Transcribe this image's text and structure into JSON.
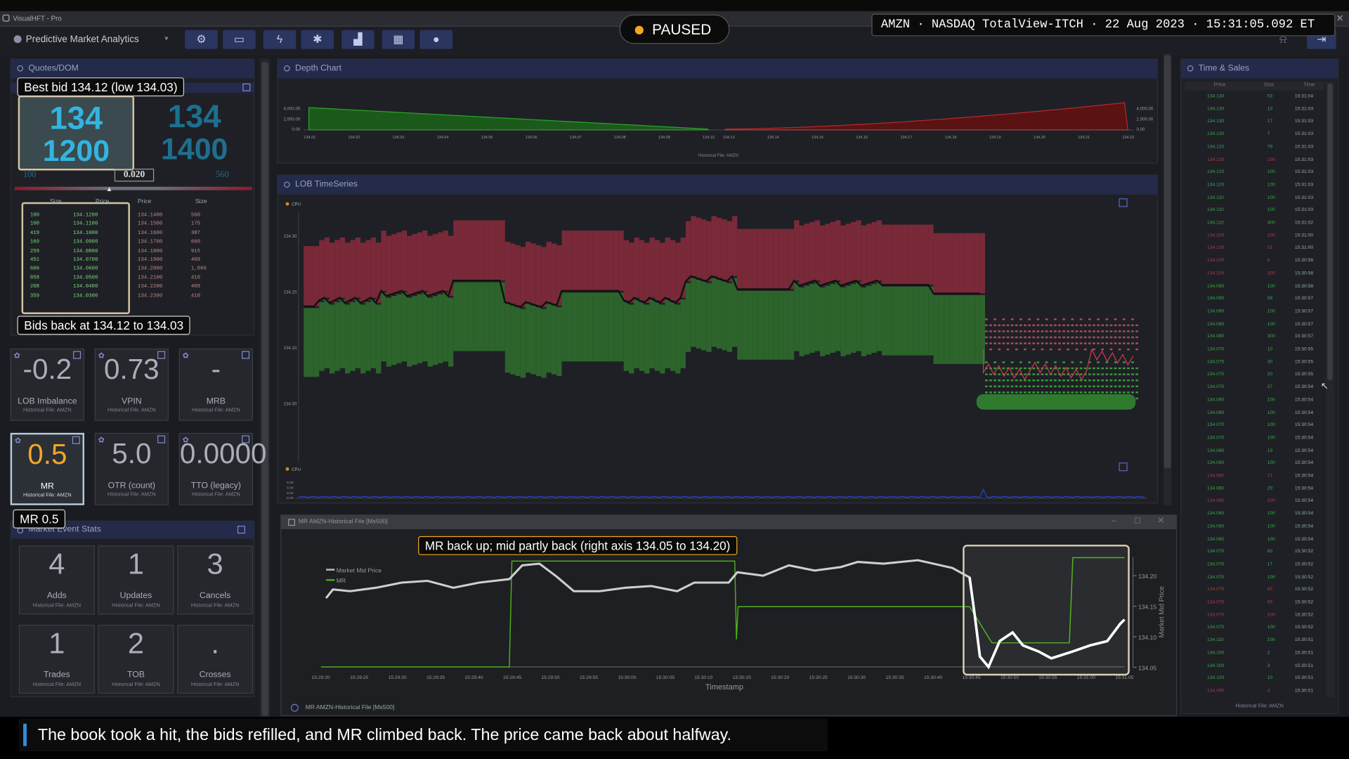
{
  "window_title": "VisualHFT - Pro",
  "app_title": "Predictive Market Analytics",
  "status": {
    "label": "PAUSED"
  },
  "header_info": "AMZN · NASDAQ TotalView-ITCH · 22 Aug 2023 · 15:31:05.092 ET",
  "toolbar": {
    "icons": [
      "gear-icon",
      "monitor-icon",
      "bolt-icon",
      "puzzle-icon",
      "chart-icon",
      "keyboard-icon",
      "user-icon",
      "bell-icon",
      "logout-icon"
    ]
  },
  "quotes": {
    "title": "Quotes/DOM",
    "bid_price": "134",
    "bid_size": "1200",
    "ask_price": "134",
    "ask_size": "1400",
    "left_small": "100",
    "spread": "0.020",
    "right_small": "560",
    "headers": {
      "bid_size": "Size",
      "bid_price": "Price",
      "ask_price": "Price",
      "ask_size": "Size"
    },
    "bids": [
      {
        "size": "100",
        "price": "134.1200"
      },
      {
        "size": "100",
        "price": "134.1100"
      },
      {
        "size": "419",
        "price": "134.1000"
      },
      {
        "size": "169",
        "price": "134.0900"
      },
      {
        "size": "259",
        "price": "134.0800"
      },
      {
        "size": "451",
        "price": "134.0700"
      },
      {
        "size": "606",
        "price": "134.0600"
      },
      {
        "size": "858",
        "price": "134.0500"
      },
      {
        "size": "268",
        "price": "134.0400"
      },
      {
        "size": "359",
        "price": "134.0300"
      }
    ],
    "asks": [
      {
        "price": "134.1400",
        "size": "560"
      },
      {
        "price": "134.1500",
        "size": "175"
      },
      {
        "price": "134.1600",
        "size": "387"
      },
      {
        "price": "134.1700",
        "size": "660"
      },
      {
        "price": "134.1800",
        "size": "915"
      },
      {
        "price": "134.1900",
        "size": "409"
      },
      {
        "price": "134.2000",
        "size": "1,066"
      },
      {
        "price": "134.2100",
        "size": "410"
      },
      {
        "price": "134.2200",
        "size": "409"
      },
      {
        "price": "134.2300",
        "size": "410"
      }
    ]
  },
  "callouts": {
    "best_bid": "Best bid 134.12 (low 134.03)",
    "bids_back": "Bids back at 134.12 to 134.03",
    "mr": "MR 0.5",
    "mr_back": "MR back up; mid partly back (right axis 134.05 to 134.20)"
  },
  "tiles": [
    {
      "value": "-0.2",
      "label": "LOB Imbalance",
      "sub": "Historical File: AMZN"
    },
    {
      "value": "0.73",
      "label": "VPIN",
      "sub": "Historical File: AMZN"
    },
    {
      "value": "-",
      "label": "MRB",
      "sub": "Historical File: AMZN"
    },
    {
      "value": "0.5",
      "label": "MR",
      "sub": "Historical File: AMZN"
    },
    {
      "value": "5.0",
      "label": "OTR (count)",
      "sub": "Historical File: AMZN"
    },
    {
      "value": "0.0000",
      "label": "TTO (legacy)",
      "sub": "Historical File: AMZN"
    }
  ],
  "market_stats": {
    "title": "Market Event Stats",
    "items": [
      {
        "value": "4",
        "label": "Adds",
        "sub": "Historical File: AMZN"
      },
      {
        "value": "1",
        "label": "Updates",
        "sub": "Historical File: AMZN"
      },
      {
        "value": "3",
        "label": "Cancels",
        "sub": "Historical File: AMZN"
      },
      {
        "value": "1",
        "label": "Trades",
        "sub": "Historical File: AMZN"
      },
      {
        "value": "2",
        "label": "TOB",
        "sub": "Historical File: AMZN"
      },
      {
        "value": ".",
        "label": "Crosses",
        "sub": "Historical File: AMZN"
      }
    ]
  },
  "depth": {
    "title": "Depth Chart",
    "yticks": [
      "4,000.00",
      "2,000.00",
      "0.00"
    ],
    "xticks_bid": [
      "134.01",
      "134.02",
      "134.03",
      "134.04",
      "134.05",
      "134.06",
      "134.07",
      "134.08",
      "134.09",
      "134.10"
    ],
    "xticks_ask": [
      "134.13",
      "134.14",
      "134.15",
      "134.16",
      "134.17",
      "134.18",
      "134.19",
      "134.20",
      "134.21",
      "134.22"
    ],
    "footer": "Historical File: AMZN"
  },
  "lob": {
    "title": "LOB TimeSeries",
    "cpu_label": "CPU",
    "yticks": [
      "134.30",
      "134.20",
      "134.10",
      "134.00"
    ],
    "yticks_lower": [
      "0.06",
      "0.04",
      "0.02",
      "0.00"
    ]
  },
  "mr_chart": {
    "window_title": "MR AMZN-Historical File [Ms500]",
    "footer": "MR AMZN-Historical File [Ms500]",
    "legend": [
      "Market Mid Price",
      "MR"
    ],
    "right_axis_label": "Market Mid Price",
    "xlabel": "Timestamp",
    "right_ticks": [
      "134.20",
      "134.15",
      "134.10",
      "134.05"
    ],
    "xticks": [
      "15:29:20",
      "15:29:25",
      "15:29:30",
      "15:29:35",
      "15:29:40",
      "15:29:45",
      "15:29:50",
      "15:29:55",
      "15:30:00",
      "15:30:05",
      "15:30:10",
      "15:30:15",
      "15:30:20",
      "15:30:25",
      "15:30:30",
      "15:30:35",
      "15:30:40",
      "15:30:45",
      "15:30:50",
      "15:30:55",
      "15:31:00",
      "15:31:05"
    ]
  },
  "time_sales": {
    "title": "Time & Sales",
    "headers": {
      "price": "Price",
      "size": "Size",
      "time": "Time"
    },
    "footer": "Historical File: AMZN",
    "rows": [
      {
        "price": "134.130",
        "size": "53",
        "time": "15:31:04",
        "c": "g"
      },
      {
        "price": "134.130",
        "size": "10",
        "time": "15:31:03",
        "c": "g"
      },
      {
        "price": "134.130",
        "size": "17",
        "time": "15:31:03",
        "c": "g"
      },
      {
        "price": "134.130",
        "size": "7",
        "time": "15:31:03",
        "c": "g"
      },
      {
        "price": "134.120",
        "size": "79",
        "time": "15:31:03",
        "c": "g"
      },
      {
        "price": "134.120",
        "size": "100",
        "time": "15:31:03",
        "c": "r"
      },
      {
        "price": "134.120",
        "size": "100",
        "time": "15:31:03",
        "c": "g"
      },
      {
        "price": "134.120",
        "size": "100",
        "time": "15:31:03",
        "c": "g"
      },
      {
        "price": "134.110",
        "size": "100",
        "time": "15:31:03",
        "c": "g"
      },
      {
        "price": "134.110",
        "size": "100",
        "time": "15:31:03",
        "c": "g"
      },
      {
        "price": "134.110",
        "size": "300",
        "time": "15:31:02",
        "c": "g"
      },
      {
        "price": "134.100",
        "size": "100",
        "time": "15:31:00",
        "c": "r"
      },
      {
        "price": "134.100",
        "size": "31",
        "time": "15:31:00",
        "c": "r"
      },
      {
        "price": "134.100",
        "size": "6",
        "time": "15:30:58",
        "c": "r"
      },
      {
        "price": "134.100",
        "size": "100",
        "time": "15:30:58",
        "c": "r"
      },
      {
        "price": "134.090",
        "size": "100",
        "time": "15:30:58",
        "c": "g"
      },
      {
        "price": "134.090",
        "size": "58",
        "time": "15:30:57",
        "c": "g"
      },
      {
        "price": "134.090",
        "size": "100",
        "time": "15:30:57",
        "c": "g"
      },
      {
        "price": "134.080",
        "size": "100",
        "time": "15:30:57",
        "c": "g"
      },
      {
        "price": "134.080",
        "size": "300",
        "time": "15:30:57",
        "c": "g"
      },
      {
        "price": "134.070",
        "size": "10",
        "time": "15:30:55",
        "c": "g"
      },
      {
        "price": "134.075",
        "size": "30",
        "time": "15:30:55",
        "c": "g"
      },
      {
        "price": "134.075",
        "size": "20",
        "time": "15:30:55",
        "c": "g"
      },
      {
        "price": "134.070",
        "size": "27",
        "time": "15:30:54",
        "c": "g"
      },
      {
        "price": "134.080",
        "size": "100",
        "time": "15:30:54",
        "c": "g"
      },
      {
        "price": "134.080",
        "size": "100",
        "time": "15:30:54",
        "c": "g"
      },
      {
        "price": "134.070",
        "size": "100",
        "time": "15:30:54",
        "c": "g"
      },
      {
        "price": "134.070",
        "size": "100",
        "time": "15:30:54",
        "c": "g"
      },
      {
        "price": "134.060",
        "size": "19",
        "time": "15:30:54",
        "c": "g"
      },
      {
        "price": "134.060",
        "size": "100",
        "time": "15:30:54",
        "c": "g"
      },
      {
        "price": "134.060",
        "size": "71",
        "time": "15:30:54",
        "c": "r"
      },
      {
        "price": "134.060",
        "size": "29",
        "time": "15:30:54",
        "c": "g"
      },
      {
        "price": "134.060",
        "size": "100",
        "time": "15:30:54",
        "c": "r"
      },
      {
        "price": "134.060",
        "size": "100",
        "time": "15:30:54",
        "c": "g"
      },
      {
        "price": "134.060",
        "size": "100",
        "time": "15:30:54",
        "c": "g"
      },
      {
        "price": "134.060",
        "size": "100",
        "time": "15:30:54",
        "c": "g"
      },
      {
        "price": "134.070",
        "size": "83",
        "time": "15:30:52",
        "c": "g"
      },
      {
        "price": "134.070",
        "size": "17",
        "time": "15:30:52",
        "c": "g"
      },
      {
        "price": "134.070",
        "size": "100",
        "time": "15:30:52",
        "c": "g"
      },
      {
        "price": "134.070",
        "size": "65",
        "time": "15:30:52",
        "c": "r"
      },
      {
        "price": "134.070",
        "size": "65",
        "time": "15:30:52",
        "c": "r"
      },
      {
        "price": "134.070",
        "size": "100",
        "time": "15:30:52",
        "c": "r"
      },
      {
        "price": "134.075",
        "size": "100",
        "time": "15:30:52",
        "c": "g"
      },
      {
        "price": "134.110",
        "size": "100",
        "time": "15:30:51",
        "c": "g"
      },
      {
        "price": "134.100",
        "size": "2",
        "time": "15:30:51",
        "c": "g"
      },
      {
        "price": "134.100",
        "size": "3",
        "time": "15:30:51",
        "c": "g"
      },
      {
        "price": "134.100",
        "size": "10",
        "time": "15:30:51",
        "c": "g"
      },
      {
        "price": "134.090",
        "size": "4",
        "time": "15:30:51",
        "c": "r"
      }
    ]
  },
  "caption": "The book took a hit, the bids refilled, and MR climbed back. The price came back about halfway.",
  "colors": {
    "accent": "#f5a623",
    "bid": "#2e7d32",
    "ask": "#b71c3c",
    "mid": "#ffffff",
    "mr": "#4caf1a"
  }
}
